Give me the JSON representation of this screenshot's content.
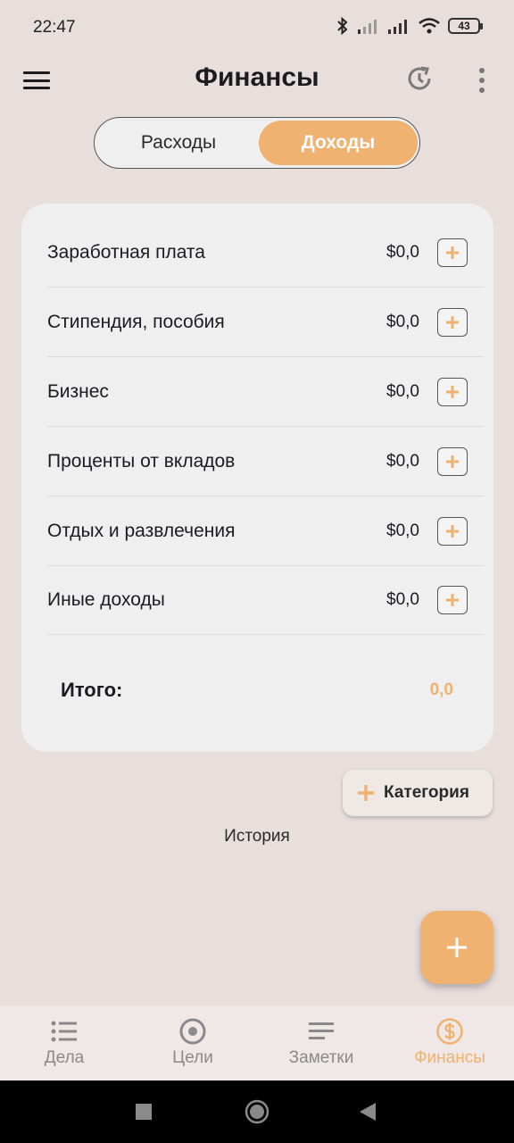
{
  "status_bar": {
    "time": "22:47",
    "battery": "43"
  },
  "app_bar": {
    "title": "Финансы"
  },
  "tabs": [
    {
      "label": "Расходы",
      "selected": false
    },
    {
      "label": "Доходы",
      "selected": true
    }
  ],
  "categories": [
    {
      "label": "Заработная плата",
      "amount": "$0,0"
    },
    {
      "label": "Стипендия, пособия",
      "amount": "$0,0"
    },
    {
      "label": "Бизнес",
      "amount": "$0,0"
    },
    {
      "label": "Проценты от вкладов",
      "amount": "$0,0"
    },
    {
      "label": "Отдых и развлечения",
      "amount": "$0,0"
    },
    {
      "label": "Иные доходы",
      "amount": "$0,0"
    }
  ],
  "total": {
    "label": "Итого:",
    "value": "0,0"
  },
  "add_category_button": {
    "label": "Категория"
  },
  "history_label": "История",
  "bottom_nav": [
    {
      "label": "Дела",
      "icon": "list-icon",
      "active": false
    },
    {
      "label": "Цели",
      "icon": "target-icon",
      "active": false
    },
    {
      "label": "Заметки",
      "icon": "notes-icon",
      "active": false
    },
    {
      "label": "Финансы",
      "icon": "dollar-icon",
      "active": true
    }
  ],
  "colors": {
    "accent": "#efb271",
    "background": "#e8dfdd",
    "card": "#efefef"
  }
}
